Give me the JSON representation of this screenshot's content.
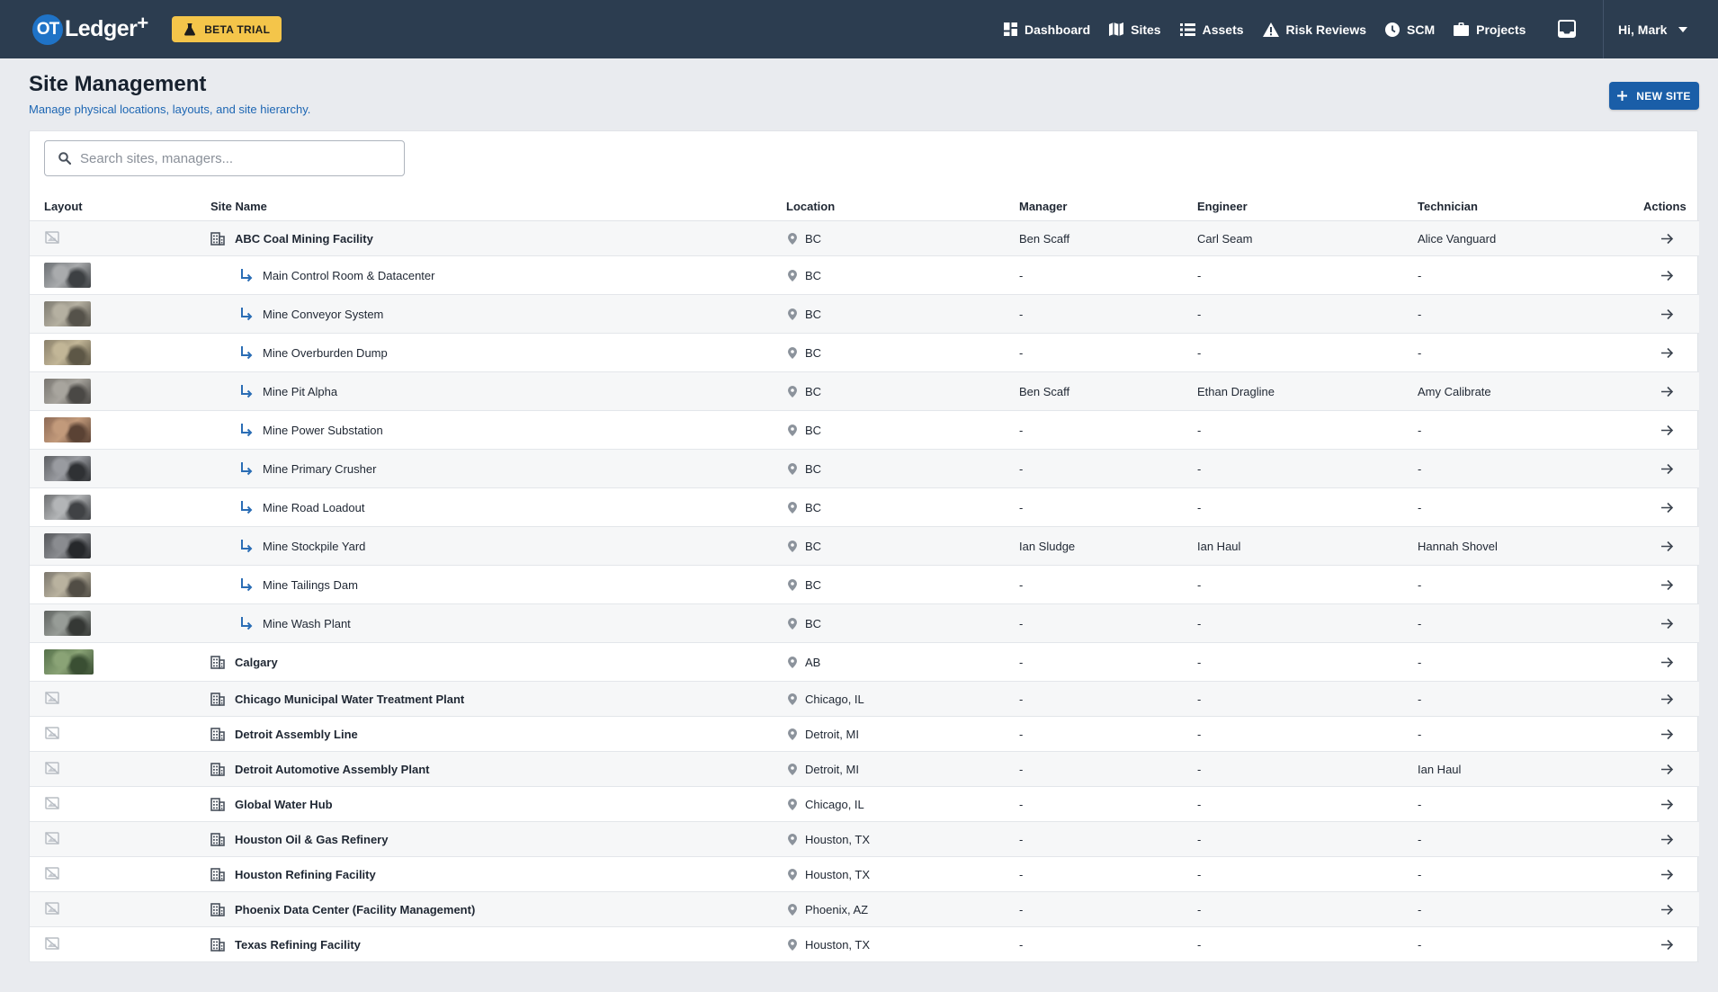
{
  "app": {
    "logo_badge": "OT",
    "logo_text": "Ledger",
    "logo_plus": "+",
    "beta_label": "BETA TRIAL"
  },
  "nav": {
    "items": [
      {
        "label": "Dashboard",
        "icon": "dashboard-icon"
      },
      {
        "label": "Sites",
        "icon": "map-icon"
      },
      {
        "label": "Assets",
        "icon": "list-icon"
      },
      {
        "label": "Risk Reviews",
        "icon": "warning-icon"
      },
      {
        "label": "SCM",
        "icon": "scm-icon"
      },
      {
        "label": "Projects",
        "icon": "briefcase-icon"
      }
    ],
    "user_greeting": "Hi, Mark"
  },
  "page": {
    "title": "Site Management",
    "subtitle": "Manage physical locations, layouts, and site hierarchy.",
    "new_site_label": "NEW SITE"
  },
  "search": {
    "placeholder": "Search sites, managers..."
  },
  "table": {
    "columns": {
      "layout": "Layout",
      "site_name": "Site Name",
      "location": "Location",
      "manager": "Manager",
      "engineer": "Engineer",
      "technician": "Technician",
      "actions": "Actions"
    },
    "rows": [
      {
        "level": "parent",
        "layout": "none",
        "name": "ABC Coal Mining Facility",
        "location": "BC",
        "manager": "Ben Scaff",
        "engineer": "Carl Seam",
        "technician": "Alice Vanguard"
      },
      {
        "level": "child",
        "layout": "image",
        "name": "Main Control Room & Datacenter",
        "location": "BC",
        "manager": "-",
        "engineer": "-",
        "technician": "-"
      },
      {
        "level": "child",
        "layout": "image",
        "name": "Mine Conveyor System",
        "location": "BC",
        "manager": "-",
        "engineer": "-",
        "technician": "-"
      },
      {
        "level": "child",
        "layout": "image",
        "name": "Mine Overburden Dump",
        "location": "BC",
        "manager": "-",
        "engineer": "-",
        "technician": "-"
      },
      {
        "level": "child",
        "layout": "image",
        "name": "Mine Pit Alpha",
        "location": "BC",
        "manager": "Ben Scaff",
        "engineer": "Ethan Dragline",
        "technician": "Amy Calibrate"
      },
      {
        "level": "child",
        "layout": "image",
        "name": "Mine Power Substation",
        "location": "BC",
        "manager": "-",
        "engineer": "-",
        "technician": "-"
      },
      {
        "level": "child",
        "layout": "image",
        "name": "Mine Primary Crusher",
        "location": "BC",
        "manager": "-",
        "engineer": "-",
        "technician": "-"
      },
      {
        "level": "child",
        "layout": "image",
        "name": "Mine Road Loadout",
        "location": "BC",
        "manager": "-",
        "engineer": "-",
        "technician": "-"
      },
      {
        "level": "child",
        "layout": "image",
        "name": "Mine Stockpile Yard",
        "location": "BC",
        "manager": "Ian Sludge",
        "engineer": "Ian Haul",
        "technician": "Hannah Shovel"
      },
      {
        "level": "child",
        "layout": "image",
        "name": "Mine Tailings Dam",
        "location": "BC",
        "manager": "-",
        "engineer": "-",
        "technician": "-"
      },
      {
        "level": "child",
        "layout": "image",
        "name": "Mine Wash Plant",
        "location": "BC",
        "manager": "-",
        "engineer": "-",
        "technician": "-"
      },
      {
        "level": "parent",
        "layout": "image",
        "name": "Calgary",
        "location": "AB",
        "manager": "-",
        "engineer": "-",
        "technician": "-"
      },
      {
        "level": "parent",
        "layout": "none",
        "name": "Chicago Municipal Water Treatment Plant",
        "location": "Chicago, IL",
        "manager": "-",
        "engineer": "-",
        "technician": "-"
      },
      {
        "level": "parent",
        "layout": "none",
        "name": "Detroit Assembly Line",
        "location": "Detroit, MI",
        "manager": "-",
        "engineer": "-",
        "technician": "-"
      },
      {
        "level": "parent",
        "layout": "none",
        "name": "Detroit Automotive Assembly Plant",
        "location": "Detroit, MI",
        "manager": "-",
        "engineer": "-",
        "technician": "Ian Haul"
      },
      {
        "level": "parent",
        "layout": "none",
        "name": "Global Water Hub",
        "location": "Chicago, IL",
        "manager": "-",
        "engineer": "-",
        "technician": "-"
      },
      {
        "level": "parent",
        "layout": "none",
        "name": "Houston Oil & Gas Refinery",
        "location": "Houston, TX",
        "manager": "-",
        "engineer": "-",
        "technician": "-"
      },
      {
        "level": "parent",
        "layout": "none",
        "name": "Houston Refining Facility",
        "location": "Houston, TX",
        "manager": "-",
        "engineer": "-",
        "technician": "-"
      },
      {
        "level": "parent",
        "layout": "none",
        "name": "Phoenix Data Center (Facility Management)",
        "location": "Phoenix, AZ",
        "manager": "-",
        "engineer": "-",
        "technician": "-"
      },
      {
        "level": "parent",
        "layout": "none",
        "name": "Texas Refining Facility",
        "location": "Houston, TX",
        "manager": "-",
        "engineer": "-",
        "technician": "-"
      }
    ]
  },
  "colors": {
    "topbar": "#2c3d50",
    "accent": "#1a5ea8",
    "beta": "#f4c54a",
    "child_arrow": "#2a6db5"
  }
}
